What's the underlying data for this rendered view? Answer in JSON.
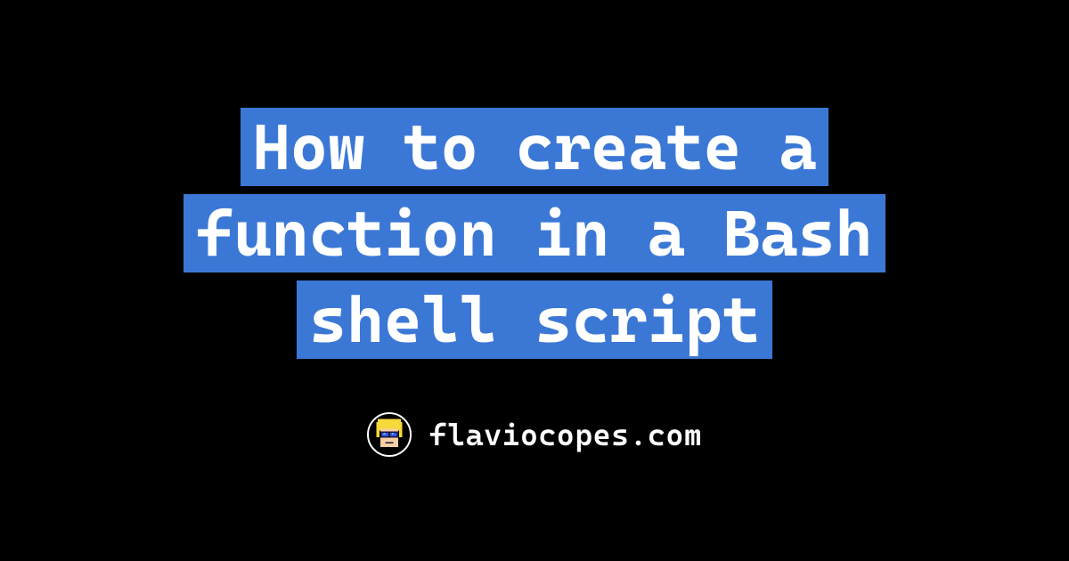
{
  "title": "How to create a function in a Bash shell script",
  "site": "flaviocopes.com",
  "colors": {
    "background": "#000000",
    "highlight": "#3b78d6",
    "text": "#ffffff"
  },
  "avatar": {
    "description": "pixel-art-face-with-sunglasses",
    "hair_color": "#f6d93a",
    "skin_color": "#f6cfa3",
    "glasses_color": "#3557e0"
  }
}
